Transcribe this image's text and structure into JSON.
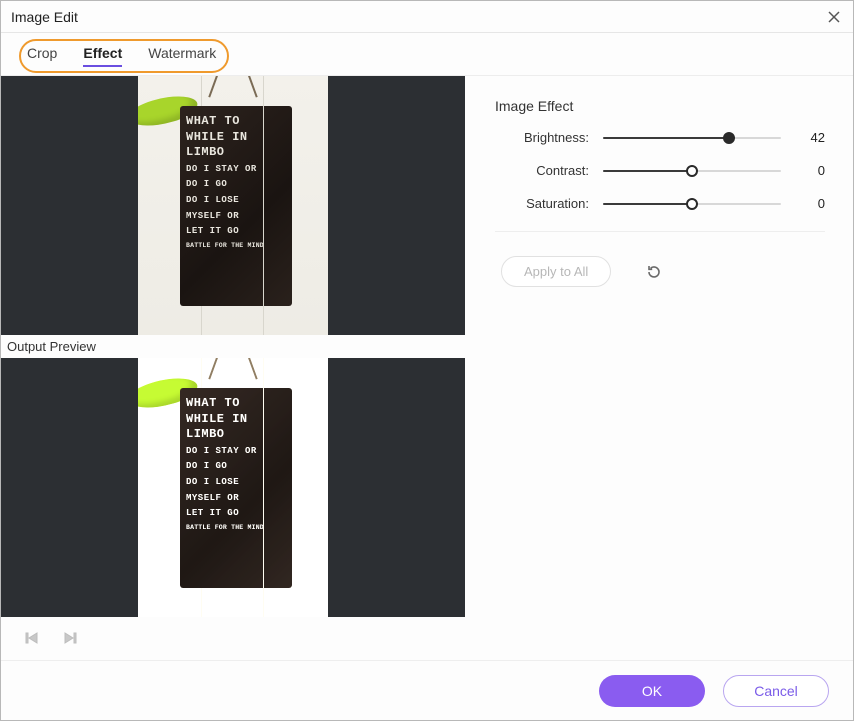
{
  "window": {
    "title": "Image Edit"
  },
  "tabs": {
    "crop": "Crop",
    "effect": "Effect",
    "watermark": "Watermark",
    "active": "effect"
  },
  "preview": {
    "output_label": "Output Preview",
    "sign_lines": {
      "l1": "WHAT TO",
      "l2": "WHILE IN",
      "l3": "LIMBO",
      "l4": "DO I STAY OR",
      "l5": "DO I GO",
      "l6": "DO I LOSE",
      "l7": "MYSELF OR",
      "l8": "LET IT GO",
      "l9": "BATTLE FOR THE MIND"
    }
  },
  "effects": {
    "section_title": "Image Effect",
    "brightness": {
      "label": "Brightness:",
      "value": 42,
      "min": -100,
      "max": 100
    },
    "contrast": {
      "label": "Contrast:",
      "value": 0,
      "min": -100,
      "max": 100
    },
    "saturation": {
      "label": "Saturation:",
      "value": 0,
      "min": -100,
      "max": 100
    },
    "apply_all": "Apply to All"
  },
  "footer": {
    "ok": "OK",
    "cancel": "Cancel"
  },
  "icons": {
    "close": "close-icon",
    "reset": "reset-icon",
    "prev": "previous-icon",
    "next": "next-icon"
  }
}
